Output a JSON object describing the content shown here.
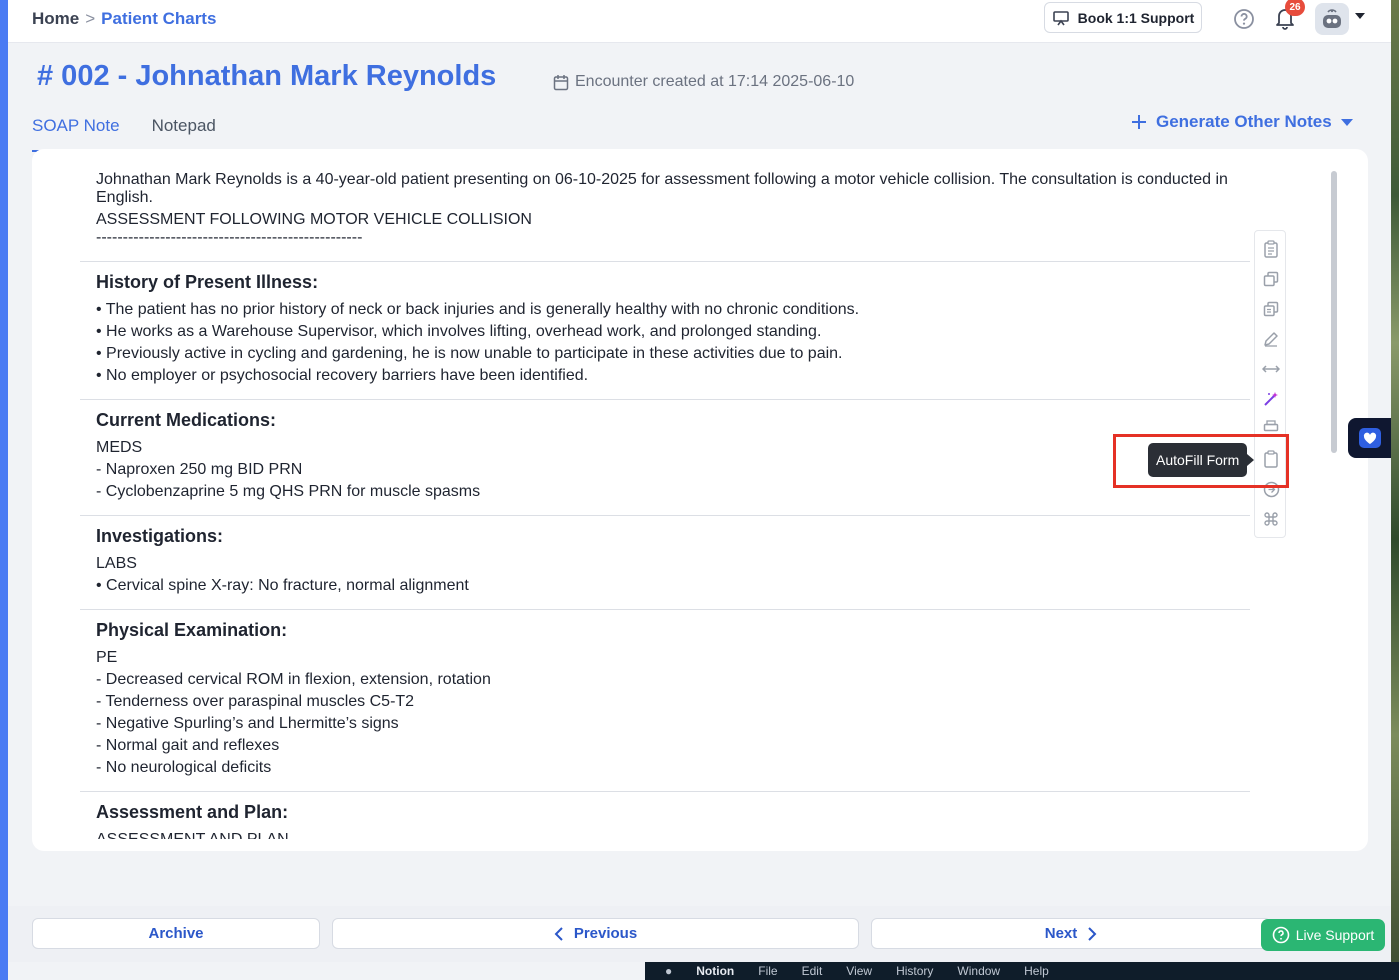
{
  "breadcrumb": {
    "home": "Home",
    "separator": ">",
    "current": "Patient Charts"
  },
  "header": {
    "support_button": "Book 1:1 Support",
    "notification_count": "26"
  },
  "encounter": {
    "title": "# 002 - Johnathan Mark Reynolds",
    "created": "Encounter created at 17:14 2025-06-10"
  },
  "tabs": [
    {
      "label": "SOAP Note"
    },
    {
      "label": "Notepad"
    }
  ],
  "generate_notes": "Generate Other Notes",
  "note": {
    "intro_1": "Johnathan Mark Reynolds is a 40-year-old patient presenting on 06-10-2025 for assessment following a motor vehicle collision. The consultation is conducted in English.",
    "intro_2": "ASSESSMENT FOLLOWING MOTOR VEHICLE COLLISION",
    "divider": "--------------------------------------------------",
    "sections": [
      {
        "heading": "History of Present Illness:",
        "lines": [
          "• The patient has no prior history of neck or back injuries and is generally healthy with no chronic conditions.",
          "• He works as a Warehouse Supervisor, which involves lifting, overhead work, and prolonged standing.",
          "• Previously active in cycling and gardening, he is now unable to participate in these activities due to pain.",
          "• No employer or psychosocial recovery barriers have been identified."
        ]
      },
      {
        "heading": "Current Medications:",
        "lines": [
          "MEDS",
          "- Naproxen 250 mg BID PRN",
          "- Cyclobenzaprine 5 mg QHS PRN for muscle spasms"
        ]
      },
      {
        "heading": "Investigations:",
        "lines": [
          "LABS",
          "• Cervical spine X-ray: No fracture, normal alignment"
        ]
      },
      {
        "heading": "Physical Examination:",
        "lines": [
          "PE",
          "- Decreased cervical ROM in flexion, extension, rotation",
          "- Tenderness over paraspinal muscles C5-T2",
          "- Negative Spurling’s and Lhermitte’s signs",
          "- Normal gait and reflexes",
          "- No neurological deficits"
        ]
      },
      {
        "heading": "Assessment and Plan:",
        "lines": [
          "ASSESSMENT AND PLAN"
        ]
      }
    ]
  },
  "tooltip": "AutoFill Form",
  "footer": {
    "archive": "Archive",
    "previous": "Previous",
    "next": "Next"
  },
  "live_support": "Live Support",
  "menubar": [
    "Notion",
    "File",
    "Edit",
    "View",
    "History",
    "Window",
    "Help"
  ],
  "colors": {
    "accent": "#3f6fe0",
    "highlight": "#e53125",
    "live_support": "#2bb673",
    "badge": "#e74c3c"
  },
  "icons": [
    "clipboard-icon",
    "copy-icon",
    "copy-all-icon",
    "edit-icon",
    "expand-icon",
    "magic-wand-icon",
    "print-icon",
    "autofill-icon",
    "info-icon",
    "command-icon"
  ]
}
